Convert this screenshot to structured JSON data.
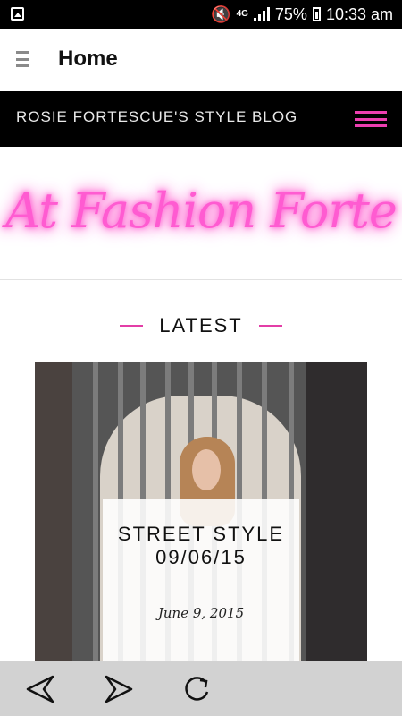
{
  "status_bar": {
    "network": "4G",
    "battery": "75%",
    "time": "10:33 am",
    "icons": [
      "gallery-icon",
      "vibrate-mute-icon",
      "signal-icon",
      "battery-icon"
    ]
  },
  "app_bar": {
    "title": "Home",
    "icon": "menu-icon"
  },
  "blog_bar": {
    "title": "ROSIE FORTESCUE'S STYLE BLOG",
    "icon": "hamburger-icon",
    "accent_color": "#ec3fb0"
  },
  "logo": {
    "text": "At Fashion Forte",
    "color": "#ff5bd1"
  },
  "section": {
    "title": "LATEST",
    "rule_color": "#e33ea7"
  },
  "post": {
    "title": "STREET STYLE\n09/06/15",
    "date": "June 9, 2015"
  },
  "bottom_nav": {
    "icons": [
      "back-arrow-icon",
      "forward-arrow-icon",
      "refresh-icon"
    ]
  }
}
